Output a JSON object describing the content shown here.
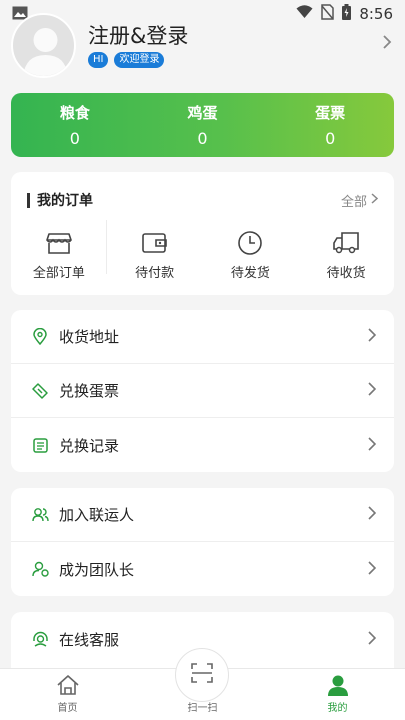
{
  "status_bar": {
    "time": "8:56"
  },
  "profile": {
    "name": "注册&登录",
    "badge_hi": "HI",
    "badge_welcome": "欢迎登录"
  },
  "stats": [
    {
      "label": "粮食",
      "value": "0"
    },
    {
      "label": "鸡蛋",
      "value": "0"
    },
    {
      "label": "蛋票",
      "value": "0"
    }
  ],
  "orders": {
    "title": "我的订单",
    "all_label": "全部",
    "items": [
      {
        "label": "全部订单",
        "icon": "store-icon"
      },
      {
        "label": "待付款",
        "icon": "wallet-icon"
      },
      {
        "label": "待发货",
        "icon": "clock-icon"
      },
      {
        "label": "待收货",
        "icon": "truck-icon"
      }
    ]
  },
  "menu_group_1": [
    {
      "label": "收货地址",
      "icon": "location-pin-icon"
    },
    {
      "label": "兑换蛋票",
      "icon": "ticket-icon"
    },
    {
      "label": "兑换记录",
      "icon": "record-icon"
    }
  ],
  "menu_group_2": [
    {
      "label": "加入联运人",
      "icon": "users-icon"
    },
    {
      "label": "成为团队长",
      "icon": "team-leader-icon"
    }
  ],
  "menu_group_3": [
    {
      "label": "在线客服",
      "icon": "headset-icon"
    }
  ],
  "tabbar": {
    "home": "首页",
    "scan": "扫一扫",
    "mine": "我的"
  },
  "colors": {
    "accent_green": "#2a9d3f",
    "badge_blue": "#1a7cd8",
    "gradient_start": "#34b451",
    "gradient_end": "#86c93c"
  }
}
